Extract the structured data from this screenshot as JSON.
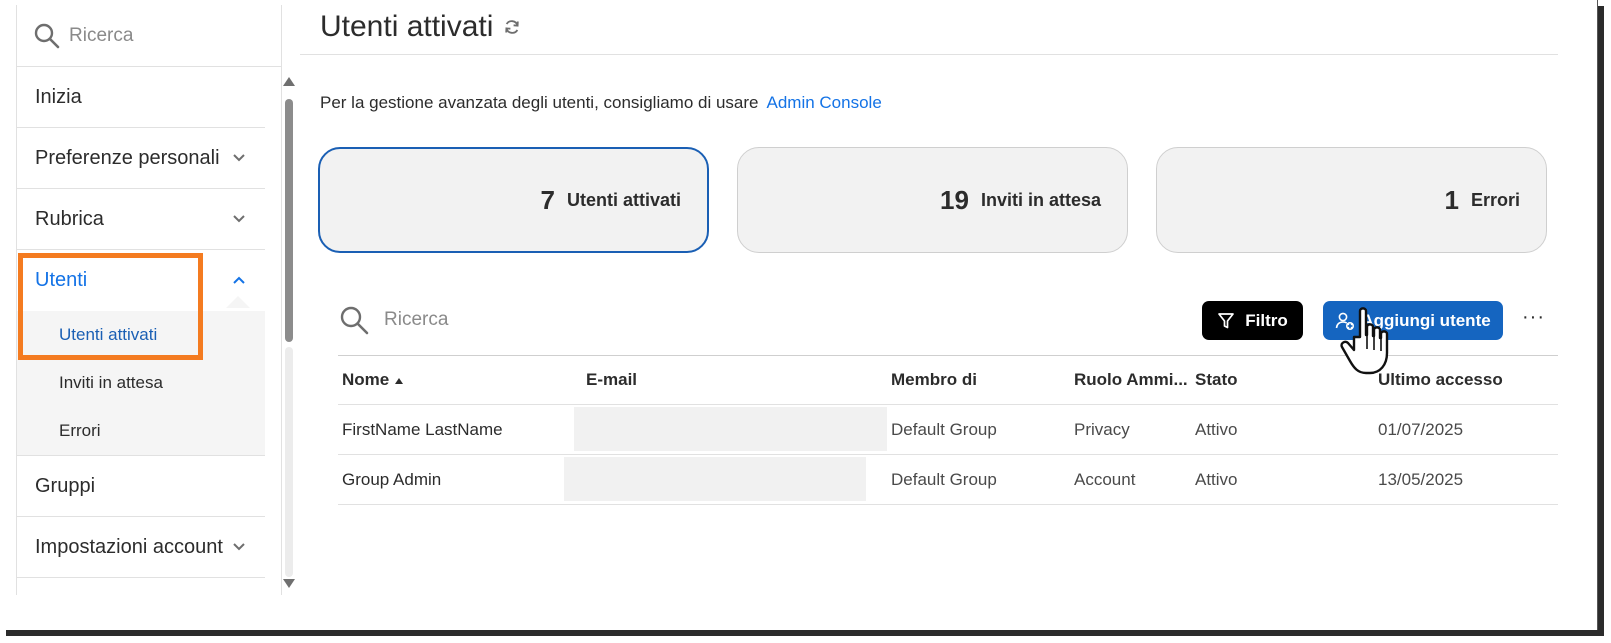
{
  "sidebar": {
    "search_placeholder": "Ricerca",
    "items": [
      {
        "label": "Inizia"
      },
      {
        "label": "Preferenze personali"
      },
      {
        "label": "Rubrica"
      },
      {
        "label": "Utenti"
      },
      {
        "label": "Gruppi"
      },
      {
        "label": "Impostazioni account"
      }
    ],
    "sub_items": [
      {
        "label": "Utenti attivati"
      },
      {
        "label": "Inviti in attesa"
      },
      {
        "label": "Errori"
      }
    ]
  },
  "main": {
    "title": "Utenti attivati",
    "intro_text": "Per la gestione avanzata degli utenti, consigliamo di usare",
    "intro_link": "Admin Console",
    "cards": [
      {
        "count": "7",
        "label": "Utenti attivati"
      },
      {
        "count": "19",
        "label": "Inviti in attesa"
      },
      {
        "count": "1",
        "label": "Errori"
      }
    ],
    "search_placeholder": "Ricerca",
    "filter_label": "Filtro",
    "add_user_label": "Aggiungi utente",
    "more_label": "···"
  },
  "table": {
    "columns": [
      "Nome",
      "E-mail",
      "Membro di",
      "Ruolo Ammi...",
      "Stato",
      "Ultimo accesso"
    ],
    "rows": [
      {
        "name": "FirstName LastName",
        "email": "",
        "group": "Default Group",
        "role": "Privacy",
        "status": "Attivo",
        "last_access": "01/07/2025"
      },
      {
        "name": "Group Admin",
        "email": "",
        "group": "Default Group",
        "role": "Account",
        "status": "Attivo",
        "last_access": "13/05/2025"
      }
    ]
  },
  "colors": {
    "accent_blue": "#1473e6",
    "button_blue": "#1565c0",
    "highlight_orange": "#f47b20",
    "card_bg": "#f2f2f2"
  },
  "icons": {
    "search": "search-icon",
    "chevron": "chevron-down-icon",
    "refresh": "refresh-icon",
    "filter": "filter-icon",
    "add_user": "add-user-icon",
    "cursor": "hand-pointer-icon"
  }
}
